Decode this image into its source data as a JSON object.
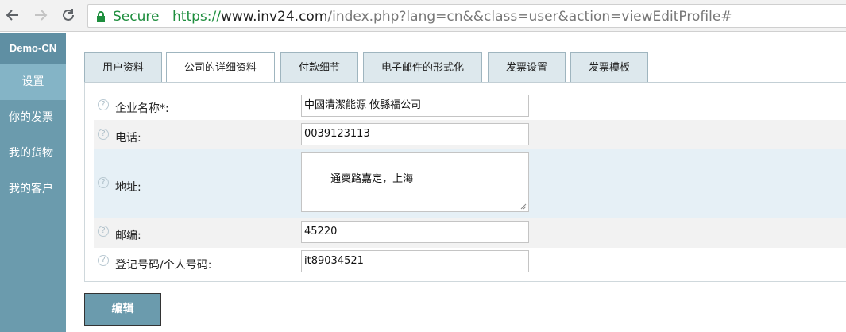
{
  "browser": {
    "secure_label": "Secure",
    "url_scheme": "https://",
    "url_host": "www.inv24.com",
    "url_path": "/index.php?lang=cn&&class=user&action=viewEditProfile#"
  },
  "sidebar": {
    "brand": "Demo-CN",
    "items": [
      {
        "label": "设置"
      },
      {
        "label": "你的发票"
      },
      {
        "label": "我的货物"
      },
      {
        "label": "我的客户"
      }
    ]
  },
  "tabs": [
    {
      "label": "用户资料"
    },
    {
      "label": "公司的详细资料"
    },
    {
      "label": "付款细节"
    },
    {
      "label": "电子邮件的形式化"
    },
    {
      "label": "发票设置"
    },
    {
      "label": "发票模板"
    }
  ],
  "form": {
    "help_glyph": "?",
    "fields": [
      {
        "label": "企业名称*:",
        "value": "中國清潔能源 攸縣福公司"
      },
      {
        "label": "电话:",
        "value": "0039123113"
      },
      {
        "label": "地址:",
        "value": "通稟路嘉定，上海"
      },
      {
        "label": "邮编:",
        "value": "45220"
      },
      {
        "label": "登记号码/个人号码:",
        "value": "it89034521"
      }
    ]
  },
  "actions": {
    "edit_label": "编辑"
  },
  "colors": {
    "sidebar": "#6b9bad",
    "sidebar_active": "#84b4c6",
    "tab_inactive": "#dde8ed",
    "secure_green": "#1e8e3e"
  }
}
